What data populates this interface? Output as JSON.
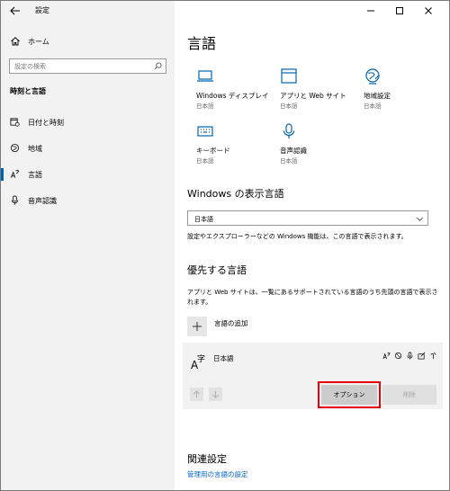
{
  "window": {
    "title": "設定",
    "controls": [
      "minimize",
      "maximize",
      "close"
    ]
  },
  "sidebar": {
    "home_label": "ホーム",
    "search_placeholder": "設定の検索",
    "section_header": "時刻と言語",
    "items": [
      {
        "label": "日付と時刻",
        "icon": "calendar-clock-icon",
        "selected": false
      },
      {
        "label": "地域",
        "icon": "globe-icon",
        "selected": false
      },
      {
        "label": "言語",
        "icon": "language-icon",
        "selected": true
      },
      {
        "label": "音声認識",
        "icon": "microphone-icon",
        "selected": false
      }
    ]
  },
  "main": {
    "title": "言語",
    "tiles": [
      {
        "name": "Windows ディスプレイ",
        "sub": "日本語",
        "icon": "display-icon"
      },
      {
        "name": "アプリと Web サイト",
        "sub": "日本語",
        "icon": "app-window-icon"
      },
      {
        "name": "地域設定",
        "sub": "日本語",
        "icon": "globe-icon"
      },
      {
        "name": "キーボード",
        "sub": "日本語",
        "icon": "keyboard-icon"
      },
      {
        "name": "音声認識",
        "sub": "日本語",
        "icon": "microphone-icon"
      }
    ],
    "display_language": {
      "heading": "Windows の表示言語",
      "selected": "日本語",
      "note": "設定やエクスプローラーなどの Windows 機能は、この言語で表示されます。"
    },
    "preferred": {
      "heading": "優先する言語",
      "note": "アプリと Web サイトは、一覧にあるサポートされている言語のうち先頭の言語で表示されます。",
      "add_label": "言語の追加",
      "language": {
        "name": "日本語",
        "glyph_a": "A",
        "glyph_ji": "字",
        "options_label": "オプション",
        "remove_label": "削除"
      }
    },
    "related": {
      "heading": "関連設定",
      "link": "管理用の言語の設定"
    }
  },
  "colors": {
    "accent": "#0063b1",
    "link": "#0066cc",
    "highlight": "#e8000b",
    "sidebar_bg": "#f2f2f2"
  }
}
